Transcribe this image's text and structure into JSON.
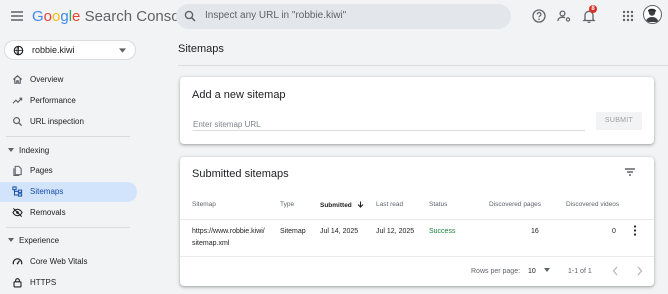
{
  "header": {
    "logo_google": [
      "G",
      "o",
      "o",
      "g",
      "l",
      "e"
    ],
    "logo_product": "Search Console",
    "search_placeholder": "Inspect any URL in \"robbie.kiwi\"",
    "notification_count": "8"
  },
  "sidebar": {
    "property": "robbie.kiwi",
    "items": [
      {
        "label": "Overview",
        "icon": "home-icon"
      },
      {
        "label": "Performance",
        "icon": "trending-up-icon"
      },
      {
        "label": "URL inspection",
        "icon": "search-icon"
      }
    ],
    "indexing": {
      "label": "Indexing",
      "items": [
        {
          "label": "Pages",
          "icon": "pages-icon"
        },
        {
          "label": "Sitemaps",
          "icon": "sitemap-icon"
        },
        {
          "label": "Removals",
          "icon": "removals-icon"
        }
      ]
    },
    "experience": {
      "label": "Experience",
      "items": [
        {
          "label": "Core Web Vitals",
          "icon": "speed-icon"
        },
        {
          "label": "HTTPS",
          "icon": "lock-icon"
        }
      ]
    }
  },
  "main": {
    "title": "Sitemaps",
    "add": {
      "heading": "Add a new sitemap",
      "placeholder": "Enter sitemap URL",
      "submit": "SUBMIT"
    },
    "submitted": {
      "heading": "Submitted sitemaps",
      "columns": [
        "Sitemap",
        "Type",
        "Submitted",
        "Last read",
        "Status",
        "Discovered pages",
        "Discovered videos"
      ],
      "rows": [
        {
          "sitemap_line1": "https://www.robbie.kiwi/",
          "sitemap_line2": "sitemap.xml",
          "type": "Sitemap",
          "submitted": "Jul 14, 2025",
          "last_read": "Jul 12, 2025",
          "status": "Success",
          "pages": "16",
          "videos": "0"
        }
      ],
      "pagination": {
        "rows_per_page_label": "Rows per page:",
        "rows_per_page": "10",
        "range": "1-1 of 1"
      }
    }
  },
  "colors": {
    "accent": "#1a73e8",
    "active_nav": "#d2e3fc",
    "success": "#188038",
    "badge": "#d93025"
  }
}
